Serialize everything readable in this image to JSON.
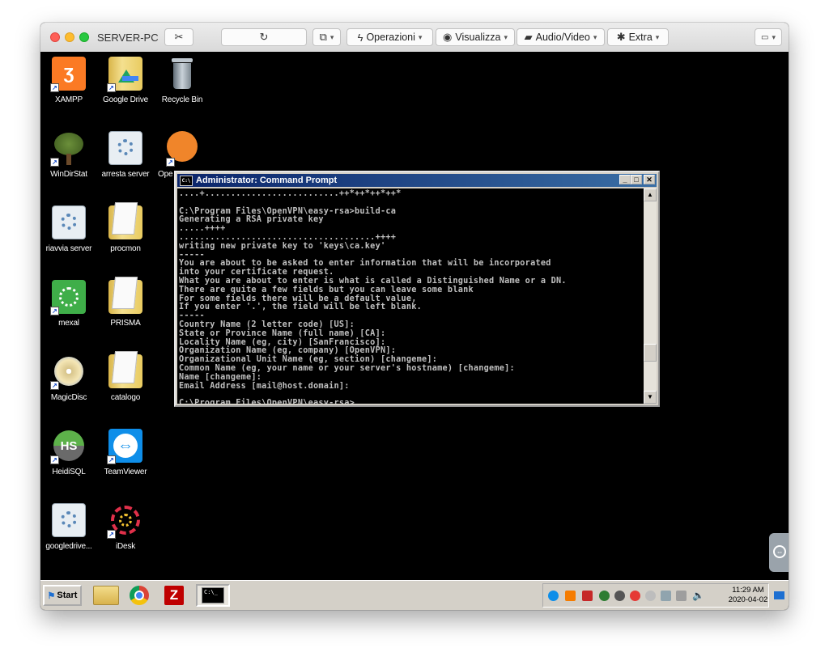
{
  "window": {
    "title": "SERVER-PC",
    "toolbar": {
      "operazioni": "Operazioni",
      "visualizza": "Visualizza",
      "audio_video": "Audio/Video",
      "extra": "Extra"
    }
  },
  "desktop_icons": [
    {
      "label": "XAMPP"
    },
    {
      "label": "Google Drive"
    },
    {
      "label": "Recycle Bin"
    },
    {
      "label": "WinDirStat"
    },
    {
      "label": "arresta server"
    },
    {
      "label": "Ope"
    },
    {
      "label": "riavvia server"
    },
    {
      "label": "procmon"
    },
    {
      "label": "mexal"
    },
    {
      "label": "PRISMA"
    },
    {
      "label": "MagicDisc"
    },
    {
      "label": "catalogo"
    },
    {
      "label": "HeidiSQL"
    },
    {
      "label": "TeamViewer"
    },
    {
      "label": "googledrive..."
    },
    {
      "label": "iDesk"
    }
  ],
  "cmd": {
    "title": "Administrator: Command Prompt",
    "lines": [
      "....+..........................++*++*++*++*",
      "",
      "C:\\Program Files\\OpenVPN\\easy-rsa>build-ca",
      "Generating a RSA private key",
      ".....++++",
      "......................................++++",
      "writing new private key to 'keys\\ca.key'",
      "-----",
      "You are about to be asked to enter information that will be incorporated",
      "into your certificate request.",
      "What you are about to enter is what is called a Distinguished Name or a DN.",
      "There are quite a few fields but you can leave some blank",
      "For some fields there will be a default value,",
      "If you enter '.', the field will be left blank.",
      "-----",
      "Country Name (2 letter code) [US]:",
      "State or Province Name (full name) [CA]:",
      "Locality Name (eg, city) [SanFrancisco]:",
      "Organization Name (eg, company) [OpenVPN]:",
      "Organizational Unit Name (eg, section) [changeme]:",
      "Common Name (eg, your name or your server's hostname) [changeme]:",
      "Name [changeme]:",
      "Email Address [mail@host.domain]:",
      "",
      "C:\\Program Files\\OpenVPN\\easy-rsa>_"
    ]
  },
  "taskbar": {
    "start": "Start",
    "clock_time": "11:29 AM",
    "clock_date": "2020-04-02"
  },
  "colors": {
    "console_bg": "#000000",
    "console_text": "#c0c0c0",
    "titlebar_active": "#0a246a",
    "taskbar": "#d4d0c8"
  }
}
